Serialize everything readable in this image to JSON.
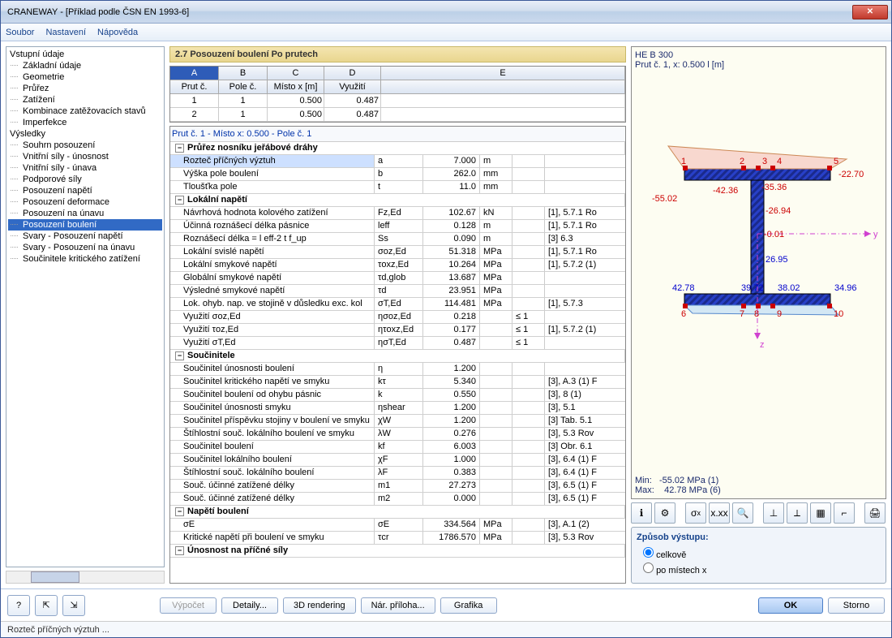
{
  "window": {
    "title": "CRANEWAY - [Příklad podle ČSN EN 1993-6]"
  },
  "menu": {
    "file": "Soubor",
    "settings": "Nastavení",
    "help": "Nápověda"
  },
  "tree": {
    "input": "Vstupní údaje",
    "input_items": [
      "Základní údaje",
      "Geometrie",
      "Průřez",
      "Zatížení",
      "Kombinace zatěžovacích stavů",
      "Imperfekce"
    ],
    "results": "Výsledky",
    "results_items": [
      "Souhrn posouzení",
      "Vnitřní síly - únosnost",
      "Vnitřní síly - únava",
      "Podporové síly",
      "Posouzení napětí",
      "Posouzení deformace",
      "Posouzení na únavu",
      "Posouzení boulení",
      "Svary - Posouzení napětí",
      "Svary - Posouzení na únavu",
      "Součinitele kritického zatížení"
    ],
    "selected": "Posouzení boulení"
  },
  "section": {
    "title": "2.7 Posouzení boulení Po prutech"
  },
  "top_table": {
    "letters": [
      "A",
      "B",
      "C",
      "D",
      "E"
    ],
    "headers": [
      "Prut č.",
      "Pole č.",
      "Místo x [m]",
      "Využití",
      ""
    ],
    "rows": [
      [
        "1",
        "1",
        "0.500",
        "0.487",
        ""
      ],
      [
        "2",
        "1",
        "0.500",
        "0.487",
        ""
      ]
    ]
  },
  "sub_header": "Prut č.  1  -  Místo x:  0.500  -  Pole č.  1",
  "groups": [
    {
      "title": "Průřez nosníku jeřábové dráhy",
      "rows": [
        {
          "label": "Rozteč příčných výztuh",
          "sym": "a",
          "val": "7.000",
          "unit": "m",
          "chk": "",
          "ref": ""
        },
        {
          "label": "Výška pole boulení",
          "sym": "b",
          "val": "262.0",
          "unit": "mm",
          "chk": "",
          "ref": ""
        },
        {
          "label": "Tloušťka pole",
          "sym": "t",
          "val": "11.0",
          "unit": "mm",
          "chk": "",
          "ref": ""
        }
      ]
    },
    {
      "title": "Lokální napětí",
      "rows": [
        {
          "label": "Návrhová hodnota kolového zatížení",
          "sym": "Fz,Ed",
          "val": "102.67",
          "unit": "kN",
          "chk": "",
          "ref": "[1], 5.7.1 Ro"
        },
        {
          "label": "Účinná roznášecí délka pásnice",
          "sym": "leff",
          "val": "0.128",
          "unit": "m",
          "chk": "",
          "ref": "[1], 5.7.1 Ro"
        },
        {
          "label": "Roznášecí délka = l eff-2 t f_up",
          "sym": "Ss",
          "val": "0.090",
          "unit": "m",
          "chk": "",
          "ref": "[3] 6.3"
        },
        {
          "label": "Lokální svislé napětí",
          "sym": "σoz,Ed",
          "val": "51.318",
          "unit": "MPa",
          "chk": "",
          "ref": "[1], 5.7.1 Ro"
        },
        {
          "label": "Lokální smykové napětí",
          "sym": "τoxz,Ed",
          "val": "10.264",
          "unit": "MPa",
          "chk": "",
          "ref": "[1], 5.7.2 (1)"
        },
        {
          "label": "Globální smykové napětí",
          "sym": "τd,glob",
          "val": "13.687",
          "unit": "MPa",
          "chk": "",
          "ref": ""
        },
        {
          "label": "Výsledné smykové napětí",
          "sym": "τd",
          "val": "23.951",
          "unit": "MPa",
          "chk": "",
          "ref": ""
        },
        {
          "label": "Lok. ohyb. nap. ve stojině v důsledku exc. kol",
          "sym": "σT,Ed",
          "val": "114.481",
          "unit": "MPa",
          "chk": "",
          "ref": "[1], 5.7.3"
        },
        {
          "label": "Využití σoz,Ed",
          "sym": "ησoz,Ed",
          "val": "0.218",
          "unit": "",
          "chk": "≤ 1",
          "ref": ""
        },
        {
          "label": "Využití τoz,Ed",
          "sym": "ητoxz,Ed",
          "val": "0.177",
          "unit": "",
          "chk": "≤ 1",
          "ref": "[1], 5.7.2 (1)"
        },
        {
          "label": "Využití σT,Ed",
          "sym": "ησT,Ed",
          "val": "0.487",
          "unit": "",
          "chk": "≤ 1",
          "ref": ""
        }
      ]
    },
    {
      "title": "Součinitele",
      "rows": [
        {
          "label": "Součinitel únosnosti boulení",
          "sym": "η",
          "val": "1.200",
          "unit": "",
          "chk": "",
          "ref": ""
        },
        {
          "label": "Součinitel kritického napětí ve smyku",
          "sym": "kτ",
          "val": "5.340",
          "unit": "",
          "chk": "",
          "ref": "[3], A.3 (1) F"
        },
        {
          "label": "Součinitel boulení od ohybu pásnic",
          "sym": "k",
          "val": "0.550",
          "unit": "",
          "chk": "",
          "ref": "[3], 8 (1)"
        },
        {
          "label": "Součinitel únosnosti smyku",
          "sym": "ηshear",
          "val": "1.200",
          "unit": "",
          "chk": "",
          "ref": "[3], 5.1"
        },
        {
          "label": "Součinitel příspěvku stojiny v boulení ve smyku",
          "sym": "χW",
          "val": "1.200",
          "unit": "",
          "chk": "",
          "ref": "[3] Tab. 5.1"
        },
        {
          "label": "Štíhlostní souč. lokálního boulení ve smyku",
          "sym": "λW",
          "val": "0.276",
          "unit": "",
          "chk": "",
          "ref": "[3], 5.3 Rov"
        },
        {
          "label": "Součinitel boulení",
          "sym": "kf",
          "val": "6.003",
          "unit": "",
          "chk": "",
          "ref": "[3] Obr. 6.1"
        },
        {
          "label": "Součinitel lokálního boulení",
          "sym": "χF",
          "val": "1.000",
          "unit": "",
          "chk": "",
          "ref": "[3], 6.4 (1) F"
        },
        {
          "label": "Štíhlostní souč. lokálního boulení",
          "sym": "λF",
          "val": "0.383",
          "unit": "",
          "chk": "",
          "ref": "[3], 6.4 (1) F"
        },
        {
          "label": "Souč. účinné zatížené délky",
          "sym": "m1",
          "val": "27.273",
          "unit": "",
          "chk": "",
          "ref": "[3], 6.5 (1) F"
        },
        {
          "label": "Souč. účinné zatížené délky",
          "sym": "m2",
          "val": "0.000",
          "unit": "",
          "chk": "",
          "ref": "[3], 6.5 (1) F"
        }
      ]
    },
    {
      "title": "Napětí boulení",
      "rows": [
        {
          "label": "σE",
          "sym": "σE",
          "val": "334.564",
          "unit": "MPa",
          "chk": "",
          "ref": "[3], A.1 (2)"
        },
        {
          "label": "Kritické napětí při boulení ve smyku",
          "sym": "τcr",
          "val": "1786.570",
          "unit": "MPa",
          "chk": "",
          "ref": "[3], 5.3 Rov"
        }
      ]
    },
    {
      "title": "Únosnost na příčné síly",
      "rows": []
    }
  ],
  "viewer": {
    "profile": "HE B 300",
    "location": "Prut č. 1, x: 0.500 l [m]",
    "min_label": "Min:",
    "min_val": "-55.02",
    "min_unit": "MPa (1)",
    "max_label": "Max:",
    "max_val": "42.78",
    "max_unit": "MPa (6)",
    "annotations": {
      "top_left": "-55.02",
      "top_mid": "-42.36",
      "top_right": "-35.36",
      "top_far": "-22.70",
      "mid_right": "-26.94",
      "zero": "-0.01",
      "low_mid": "26.95",
      "bot_left": "42.78",
      "bot_ml": "39.72",
      "bot_mr": "38.02",
      "bot_right": "34.96",
      "node1": "1",
      "node2": "2",
      "node3": "3",
      "node4": "4",
      "node5": "5",
      "node6": "6",
      "node7": "7",
      "node8": "8",
      "node9": "9",
      "node10": "10",
      "axis_y": "y",
      "axis_z": "z"
    }
  },
  "output_mode": {
    "title": "Způsob výstupu:",
    "opt1": "celkově",
    "opt2": "po místech x"
  },
  "buttons": {
    "calc": "Výpočet",
    "details": "Detaily...",
    "render": "3D rendering",
    "attach": "Nár. příloha...",
    "graphic": "Grafika",
    "ok": "OK",
    "cancel": "Storno"
  },
  "status": "Rozteč příčných výztuh ..."
}
